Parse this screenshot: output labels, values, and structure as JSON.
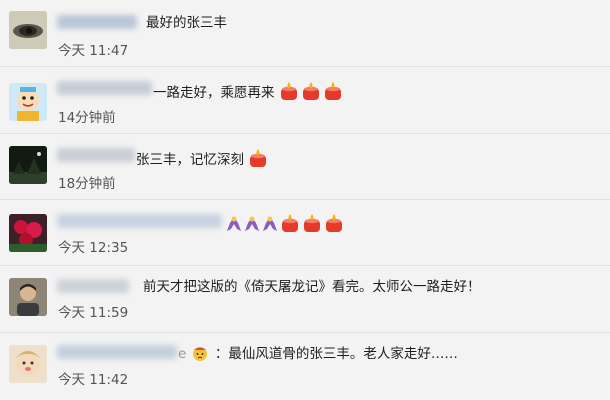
{
  "comments": [
    {
      "text": "最好的张三丰",
      "time": "今天 11:47",
      "avatar": "avatar-eye",
      "emojis": []
    },
    {
      "text": "一路走好，乘愿再来",
      "time": "14分钟前",
      "avatar": "avatar-cartoon",
      "emojis": [
        "candle-icon",
        "candle-icon",
        "candle-icon"
      ]
    },
    {
      "text": "张三丰，记忆深刻",
      "time": "18分钟前",
      "avatar": "avatar-dark-scene",
      "emojis": [
        "candle-icon"
      ]
    },
    {
      "text": "",
      "time": "今天 12:35",
      "avatar": "avatar-roses",
      "emojis": [
        "ribbon-icon",
        "ribbon-icon",
        "ribbon-icon",
        "candle-icon",
        "candle-icon",
        "candle-icon"
      ]
    },
    {
      "text": "前天才把这版的《倚天屠龙记》看完。太师公一路走好！",
      "time": "今天 11:59",
      "avatar": "avatar-man",
      "emojis": []
    },
    {
      "text": "：最仙风道骨的张三丰。老人家走好……",
      "time": "今天 11:42",
      "avatar": "avatar-baby",
      "emojis": [],
      "name_suffix": "e"
    }
  ],
  "colors": {
    "background": "#f3f3f3",
    "candle_red": "#e53a2a",
    "candle_flame": "#f5b200",
    "ribbon": "#8a5bc6"
  }
}
